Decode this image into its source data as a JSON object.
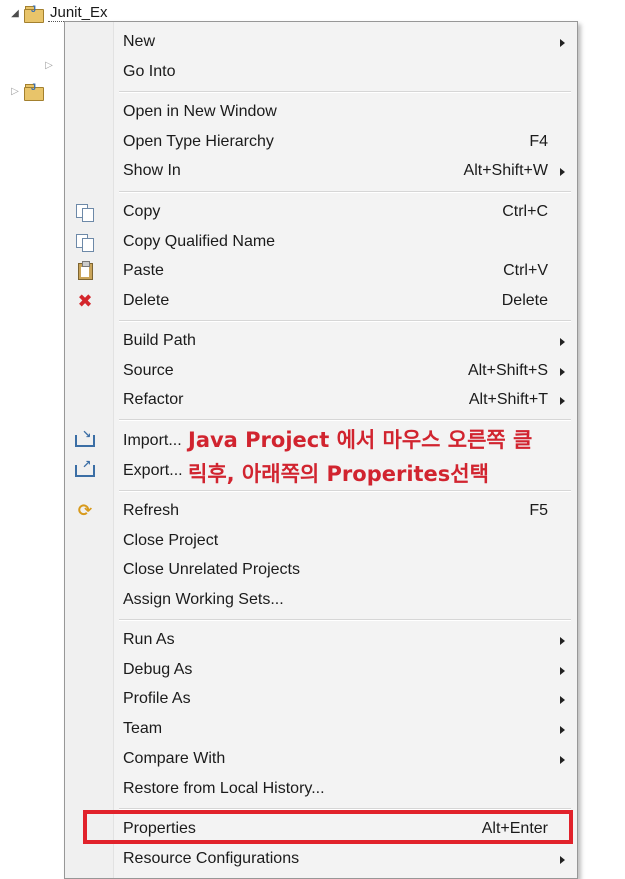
{
  "tree": {
    "project_label": "Junit_Ex"
  },
  "menu": {
    "items": [
      {
        "label": "New",
        "shortcut": "",
        "submenu": true
      },
      {
        "label": "Go Into",
        "shortcut": "",
        "submenu": false
      },
      {
        "label": "Open in New Window",
        "shortcut": "",
        "submenu": false
      },
      {
        "label": "Open Type Hierarchy",
        "shortcut": "F4",
        "submenu": false
      },
      {
        "label": "Show In",
        "shortcut": "Alt+Shift+W",
        "submenu": true
      },
      {
        "label": "Copy",
        "shortcut": "Ctrl+C",
        "submenu": false,
        "icon": "copy-icon"
      },
      {
        "label": "Copy Qualified Name",
        "shortcut": "",
        "submenu": false,
        "icon": "copy-qualified-name-icon"
      },
      {
        "label": "Paste",
        "shortcut": "Ctrl+V",
        "submenu": false,
        "icon": "paste-icon"
      },
      {
        "label": "Delete",
        "shortcut": "Delete",
        "submenu": false,
        "icon": "delete-icon"
      },
      {
        "label": "Build Path",
        "shortcut": "",
        "submenu": true
      },
      {
        "label": "Source",
        "shortcut": "Alt+Shift+S",
        "submenu": true
      },
      {
        "label": "Refactor",
        "shortcut": "Alt+Shift+T",
        "submenu": true
      },
      {
        "label": "Import...",
        "shortcut": "",
        "submenu": false,
        "icon": "import-icon"
      },
      {
        "label": "Export...",
        "shortcut": "",
        "submenu": false,
        "icon": "export-icon"
      },
      {
        "label": "Refresh",
        "shortcut": "F5",
        "submenu": false,
        "icon": "refresh-icon"
      },
      {
        "label": "Close Project",
        "shortcut": "",
        "submenu": false
      },
      {
        "label": "Close Unrelated Projects",
        "shortcut": "",
        "submenu": false
      },
      {
        "label": "Assign Working Sets...",
        "shortcut": "",
        "submenu": false
      },
      {
        "label": "Run As",
        "shortcut": "",
        "submenu": true
      },
      {
        "label": "Debug As",
        "shortcut": "",
        "submenu": true
      },
      {
        "label": "Profile As",
        "shortcut": "",
        "submenu": true
      },
      {
        "label": "Team",
        "shortcut": "",
        "submenu": true
      },
      {
        "label": "Compare With",
        "shortcut": "",
        "submenu": true
      },
      {
        "label": "Restore from Local History...",
        "shortcut": "",
        "submenu": false
      },
      {
        "label": "Properties",
        "shortcut": "Alt+Enter",
        "submenu": false
      },
      {
        "label": "Resource Configurations",
        "shortcut": "",
        "submenu": true
      }
    ]
  },
  "annotation": {
    "line1": "Java Project 에서 마우스 오른쪽 클",
    "line2": "릭후, 아래쪽의 Properites선택"
  },
  "colors": {
    "annotation": "#d1242f",
    "highlight_box": "#e1222b",
    "menu_bg": "#f3f3f3"
  }
}
